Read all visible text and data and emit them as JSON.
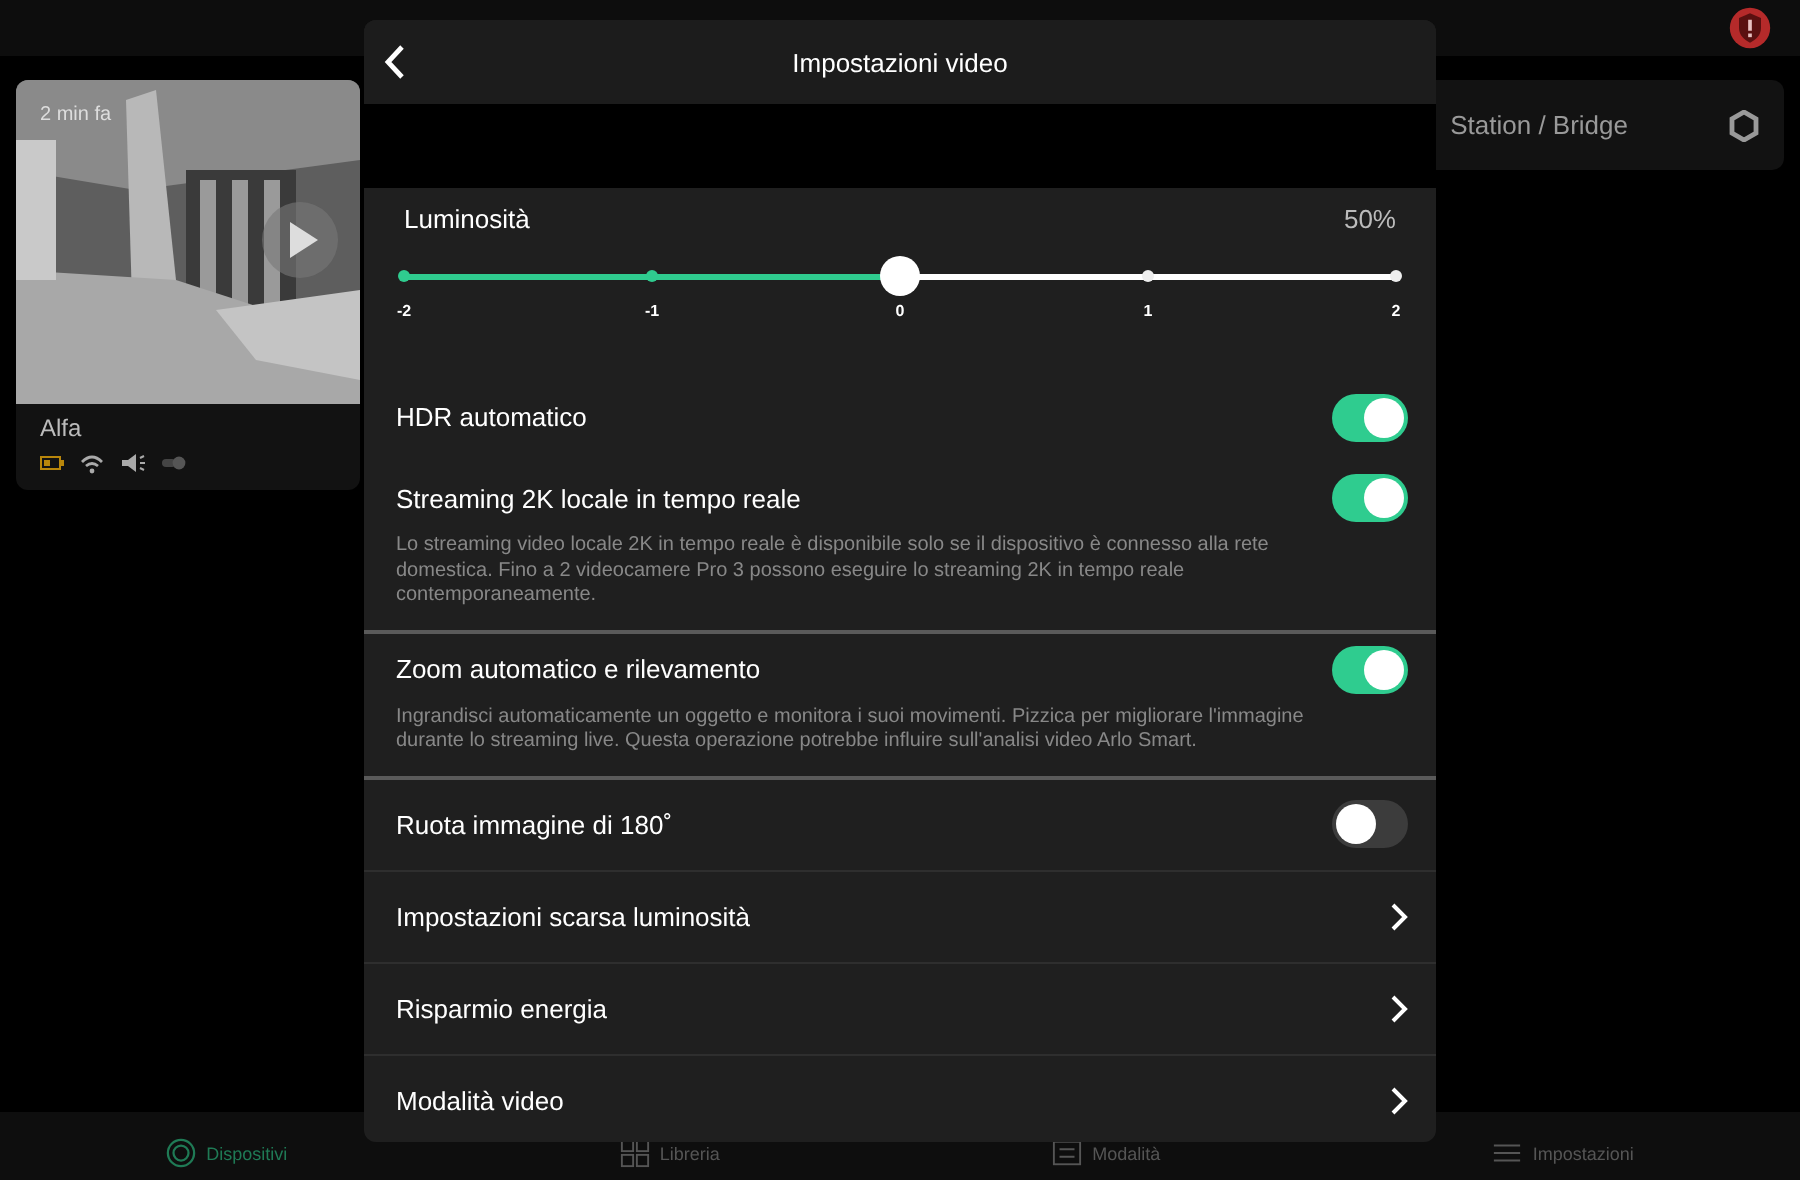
{
  "camera_card": {
    "time": "2 min fa",
    "name": "Alfa"
  },
  "station_card": {
    "label": "Station / Bridge"
  },
  "modal": {
    "title": "Impostazioni video",
    "brightness": {
      "label": "Luminosità",
      "reading": "50%",
      "level": 0.5,
      "ticks": [
        "-2",
        "-1",
        "0",
        "1",
        "2"
      ]
    },
    "rows": [
      {
        "kind": "toggle",
        "label": "HDR automatico",
        "on": true
      },
      {
        "kind": "toggle",
        "label": "Streaming 2K locale in tempo reale",
        "on": true,
        "description": "Lo streaming video locale 2K in tempo reale è disponibile solo se il dispositivo è connesso alla rete domestica. Fino a 2 videocamere Pro 3 possono eseguire lo streaming 2K in tempo reale contemporaneamente."
      },
      {
        "kind": "toggle",
        "label": "Zoom automatico e rilevamento",
        "on": true,
        "description": "Ingrandisci automaticamente un oggetto e monitora i suoi movimenti. Pizzica per migliorare l'immagine durante lo streaming live. Questa operazione potrebbe influire sull'analisi video Arlo Smart."
      },
      {
        "kind": "toggle",
        "label": "Ruota immagine di 180˚",
        "on": false
      },
      {
        "kind": "link",
        "label": "Impostazioni scarsa luminosità"
      },
      {
        "kind": "link",
        "label": "Risparmio energia"
      },
      {
        "kind": "link",
        "label": "Modalità video"
      }
    ]
  },
  "tabs": [
    {
      "label": "Dispositivi",
      "selected": true
    },
    {
      "label": "Libreria",
      "selected": false
    },
    {
      "label": "Modalità",
      "selected": false
    },
    {
      "label": "Impostazioni",
      "selected": false
    }
  ]
}
